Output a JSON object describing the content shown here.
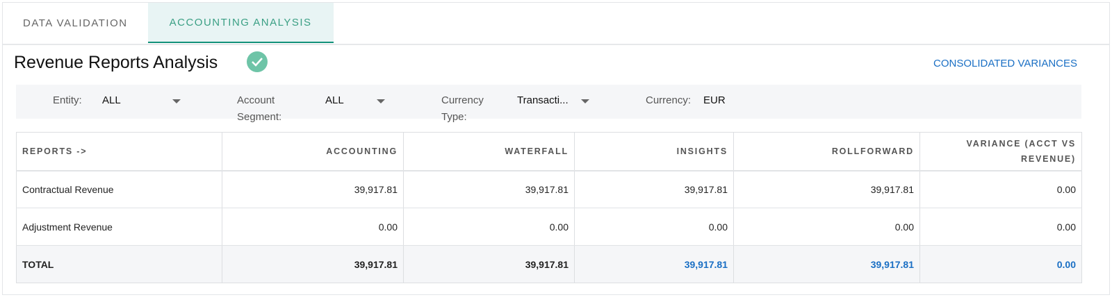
{
  "tabs": [
    "DATA VALIDATION",
    "ACCOUNTING ANALYSIS"
  ],
  "title": "Revenue Reports Analysis",
  "consolidated_link": "CONSOLIDATED VARIANCES",
  "filters": {
    "entity_label": "Entity:",
    "entity_value": "ALL",
    "segment_label_1": "Account",
    "segment_label_2": "Segment:",
    "segment_value": "ALL",
    "ctype_label_1": "Currency",
    "ctype_label_2": "Type:",
    "ctype_value": "Transacti...",
    "currency_label": "Currency:",
    "currency_value": "EUR"
  },
  "table": {
    "headers": [
      "REPORTS ->",
      "ACCOUNTING",
      "WATERFALL",
      "INSIGHTS",
      "ROLLFORWARD",
      "VARIANCE (ACCT VS REVENUE)"
    ],
    "rows": [
      [
        "Contractual Revenue",
        "39,917.81",
        "39,917.81",
        "39,917.81",
        "39,917.81",
        "0.00"
      ],
      [
        "Adjustment Revenue",
        "0.00",
        "0.00",
        "0.00",
        "0.00",
        "0.00"
      ],
      [
        "TOTAL",
        "39,917.81",
        "39,917.81",
        "39,917.81",
        "39,917.81",
        "0.00"
      ]
    ]
  }
}
